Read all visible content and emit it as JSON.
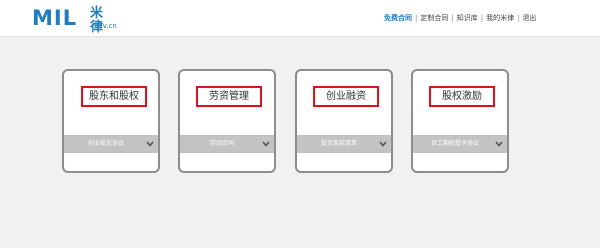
{
  "logo": {
    "mark": "MIL",
    "cn": "米律",
    "domain": "milv.cn"
  },
  "topnav": {
    "items": [
      "免费合同",
      "定制合同",
      "知识库",
      "我的米律",
      "退出"
    ],
    "active_index": 0,
    "separator": "|",
    "accent_color": "#1e7dc0"
  },
  "cards": [
    {
      "title": "股东和股权",
      "bar_label": "创业股东协议",
      "icon": "chevron-down-icon"
    },
    {
      "title": "劳资管理",
      "bar_label": "劳动合同",
      "icon": "chevron-down-icon"
    },
    {
      "title": "创业融资",
      "bar_label": "投资条款清单",
      "icon": "chevron-down-icon"
    },
    {
      "title": "股权激励",
      "bar_label": "员工期权授予协议",
      "icon": "chevron-down-icon"
    }
  ],
  "colors": {
    "highlight_border": "#e0101a",
    "card_border": "#8d8d8d",
    "bar_background": "#c3c3c3",
    "page_background": "#f1f1f1"
  }
}
